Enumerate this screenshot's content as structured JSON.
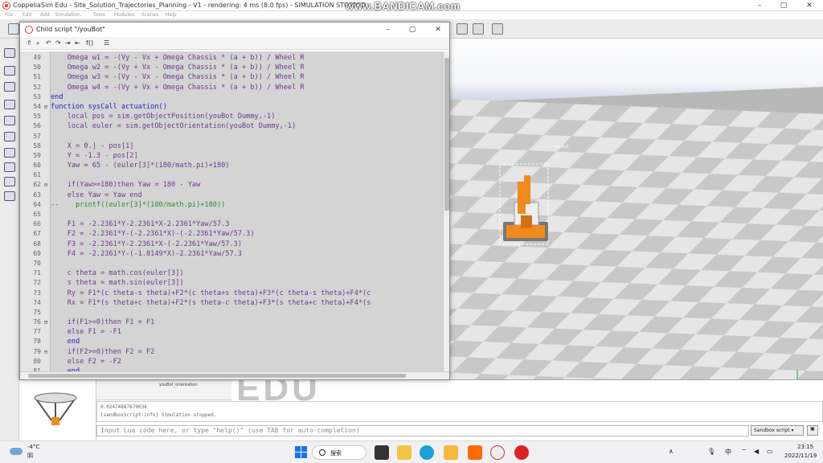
{
  "window": {
    "title": "CoppeliaSim Edu - Site_Solution_Trajectories_Planning - V1 - rendering: 4 ms (8.0 fps) - SIMULATION STOPPED",
    "watermark": "www.BANDICAM.com",
    "minimize": "–",
    "maximize": "▢",
    "close": "✕"
  },
  "menu": [
    "File",
    "Edit",
    "Add",
    "Simulation",
    "Tools",
    "Modules",
    "Scenes",
    "Help"
  ],
  "editor": {
    "title": "Child script \"/youBot\"",
    "minimize": "–",
    "maximize": "▢",
    "close": "✕",
    "lines": [
      {
        "num": "49",
        "fold": "",
        "text": "    Omega w1 = -(Vy - Vx + Omega Chassis * (a + b)) / Wheel R"
      },
      {
        "num": "50",
        "fold": "",
        "text": "    Omega w2 = -(Vy + Vx - Omega Chassis * (a + b)) / Wheel R"
      },
      {
        "num": "51",
        "fold": "",
        "text": "    Omega w3 = -(Vy - Vx - Omega Chassis * (a + b)) / Wheel R"
      },
      {
        "num": "52",
        "fold": "",
        "text": "    Omega w4 = -(Vy + Vx + Omega Chassis * (a + b)) / Wheel R"
      },
      {
        "num": "53",
        "fold": "",
        "text": "end"
      },
      {
        "num": "54",
        "fold": "⊟",
        "text": "function sysCall actuation()"
      },
      {
        "num": "55",
        "fold": "",
        "text": "    local pos = sim.getObjectPosition(youBot Dummy,-1)"
      },
      {
        "num": "56",
        "fold": "",
        "text": "    local euler = sim.getObjectOrientation(youBot Dummy,-1)"
      },
      {
        "num": "57",
        "fold": "",
        "text": ""
      },
      {
        "num": "58",
        "fold": "",
        "text": "    X = 0.| - pos[1]"
      },
      {
        "num": "59",
        "fold": "",
        "text": "    Y = -1.3 - pos[2]"
      },
      {
        "num": "60",
        "fold": "",
        "text": "    Yaw = 65 - (euler[3]*(180/math.pi)+180)"
      },
      {
        "num": "61",
        "fold": "",
        "text": ""
      },
      {
        "num": "62",
        "fold": "⊟",
        "text": "    if(Yaw>=180)then Yaw = 180 - Yaw"
      },
      {
        "num": "63",
        "fold": "",
        "text": "    else Yaw = Yaw end"
      },
      {
        "num": "64",
        "fold": "",
        "text": "--    printf((euler[3]*(180/math.pi)+180))"
      },
      {
        "num": "65",
        "fold": "",
        "text": ""
      },
      {
        "num": "66",
        "fold": "",
        "text": "    F1 = -2.2361*Y-2.2361*X-2.2361*Yaw/57.3"
      },
      {
        "num": "67",
        "fold": "",
        "text": "    F2 = -2.2361*Y-(-2.2361*X)-(-2.2361*Yaw/57.3)"
      },
      {
        "num": "68",
        "fold": "",
        "text": "    F3 = -2.2361*Y-2.2361*X-(-2.2361*Yaw/57.3)"
      },
      {
        "num": "69",
        "fold": "",
        "text": "    F4 = -2.2361*Y-(-1.8149*X)-2.2361*Yaw/57.3"
      },
      {
        "num": "70",
        "fold": "",
        "text": ""
      },
      {
        "num": "71",
        "fold": "",
        "text": "    c theta = math.cos(euler[3])"
      },
      {
        "num": "72",
        "fold": "",
        "text": "    s theta = math.sin(euler[3])"
      },
      {
        "num": "73",
        "fold": "",
        "text": "    Ry = F1*(c theta-s theta)+F2*(c theta+s theta)+F3*(c theta-s theta)+F4*(c"
      },
      {
        "num": "74",
        "fold": "",
        "text": "    Rx = F1*(s theta+c theta)+F2*(s theta-c theta)+F3*(s theta+c theta)+F4*(s"
      },
      {
        "num": "75",
        "fold": "",
        "text": ""
      },
      {
        "num": "76",
        "fold": "⊟",
        "text": "    if(F1>=0)then F1 = F1"
      },
      {
        "num": "77",
        "fold": "",
        "text": "    else F1 = -F1"
      },
      {
        "num": "78",
        "fold": "",
        "text": "    end"
      },
      {
        "num": "79",
        "fold": "⊟",
        "text": "    if(F2>=0)then F2 = F2"
      },
      {
        "num": "80",
        "fold": "",
        "text": "    else F2 = -F2"
      },
      {
        "num": "81",
        "fold": "",
        "text": "    end"
      }
    ]
  },
  "scene": {
    "robot_label": "youBot",
    "tree_item": "youBot_orientation",
    "edu_watermark": "EDU"
  },
  "status": {
    "line1": "0.02474887679034",
    "line2": "[sandboxScript:info] Simulation stopped.",
    "input_placeholder": "Input Lua code here, or type \"help()\" (use TAB for auto-completion)",
    "sandbox_select": "Sandbox script ▾",
    "sandbox_btn": "▣"
  },
  "taskbar": {
    "temp": "-4°C",
    "condition": "阴",
    "search": "搜索",
    "tray_up": "∧",
    "ime": "中",
    "time": "23:15",
    "date": "2022/11/19"
  },
  "colors": {
    "keyword": "#2222cc",
    "number": "#cc44aa",
    "comment": "#2e8b2e",
    "accent": "#1a73e8"
  }
}
